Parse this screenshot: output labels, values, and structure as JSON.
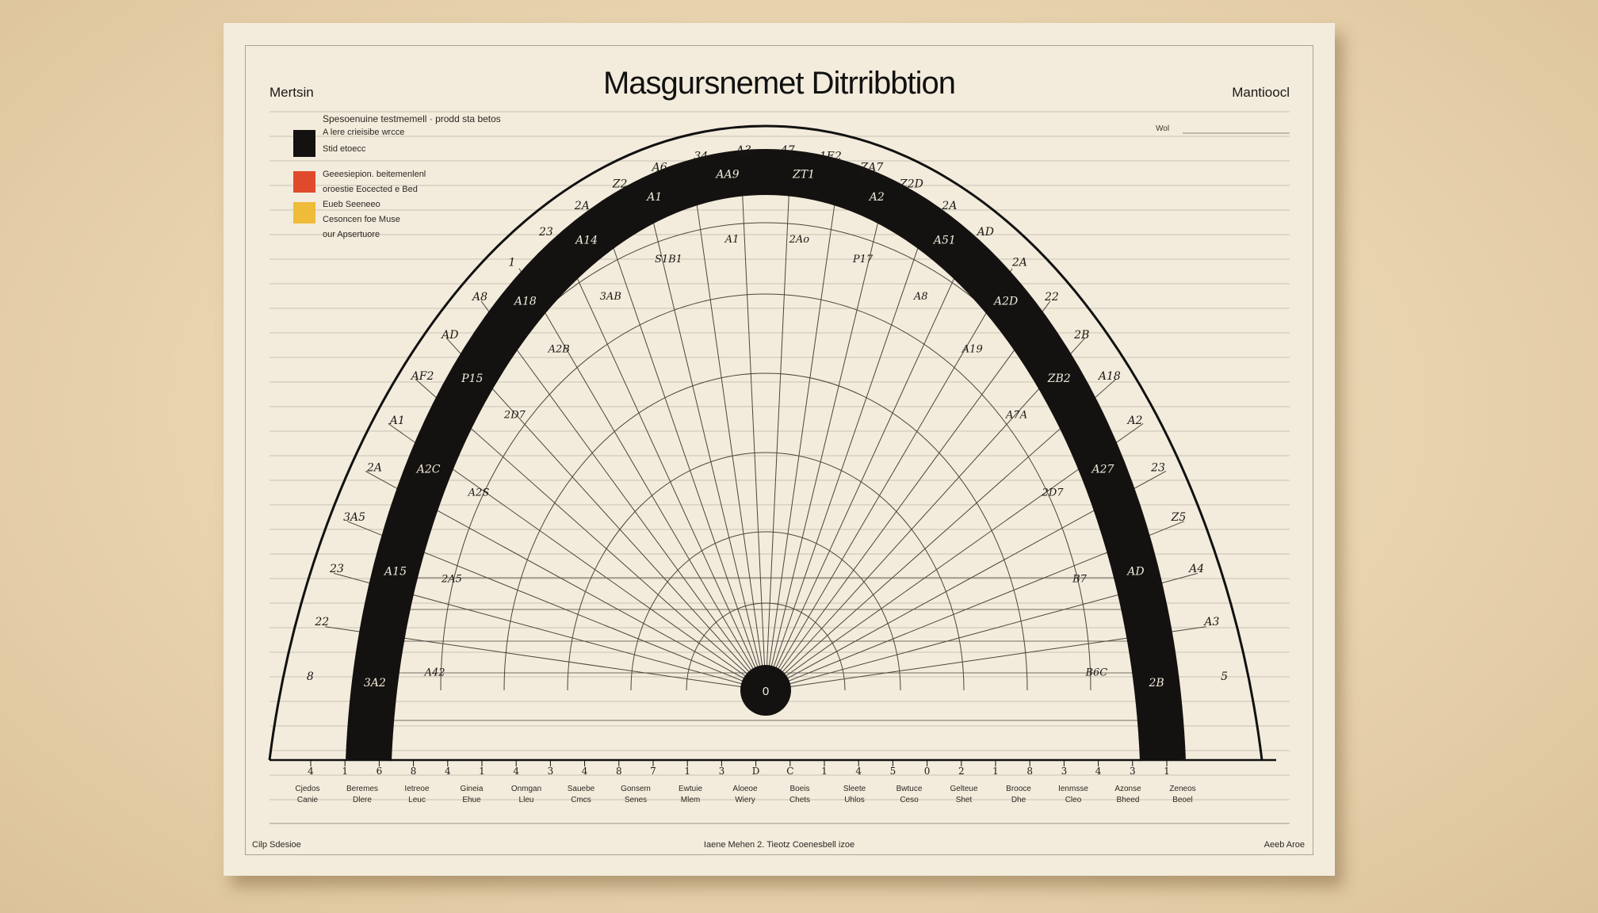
{
  "document": {
    "title": "Masgursnemet Ditrribbtion",
    "corner_left": "Mertsin",
    "corner_right": "Mantioocl",
    "right_label": "Wol",
    "legend": {
      "heading": "Spesoenuine testmemell · prodd sta betos",
      "items": [
        {
          "color": "#141210",
          "lines": [
            "A lere crieisibe wrcce",
            "Stid etoecc"
          ]
        },
        {
          "color": "#e04a2c",
          "lines": [
            "Geeesiepion. beitemenlenl",
            "oroestie Eocected e Bed"
          ]
        },
        {
          "color": "#efbc3a",
          "lines": [
            "Eueb Seeneeo",
            "Cesoncen foe Muse"
          ]
        }
      ],
      "extra_line": "our Apsertuore"
    },
    "footer": {
      "left": "Cilp Sdesioe",
      "center": "Iaene Mehen 2. Tieotz Coenesbell izoe",
      "right": "Aeeb Aroe"
    }
  },
  "diagram": {
    "colors": {
      "ink": "#111111",
      "grid": "#4a453d",
      "band": "#141210",
      "paper": "#f3ecdc"
    },
    "band_labels": [
      "3A2",
      "A15",
      "A2C",
      "P15",
      "A18",
      "A14",
      "A1",
      "AA9",
      "ZT1",
      "A2",
      "A51",
      "A2D",
      "ZB2",
      "A27",
      "AD",
      "2B"
    ],
    "inner_labels": [
      "A42",
      "2A5",
      "A2S",
      "2D7",
      "A2B",
      "3AB",
      "S1B1",
      "A1",
      "2Ao",
      "P17",
      "A8",
      "A19",
      "A7A",
      "2D7",
      "B7",
      "B6C"
    ],
    "outer_labels": [
      "8",
      "22",
      "23",
      "3A5",
      "2A",
      "A1",
      "AF2",
      "AD",
      "A8",
      "1",
      "23",
      "2A",
      "Z2",
      "A6",
      "34",
      "A3",
      "47",
      "1E2",
      "ZA7",
      "Z2D",
      "2A",
      "AD",
      "2A",
      "22",
      "2B",
      "A18",
      "A2",
      "23",
      "Z5",
      "A4",
      "A3",
      "5"
    ],
    "baseline_ticks": [
      "4",
      "1",
      "6",
      "8",
      "4",
      "1",
      "4",
      "3",
      "4",
      "8",
      "7",
      "1",
      "3",
      "D",
      "C",
      "1",
      "4",
      "5",
      "0",
      "2",
      "1",
      "8",
      "3",
      "4",
      "3",
      "1"
    ],
    "baseline_captions": [
      "Cjedos Canie",
      "Beremes Dlere",
      "Ietreoe Leuc",
      "Gineia Ehue",
      "Onmgan Lleu",
      "Sauebe Cmcs",
      "Gonsem Senes",
      "Ewtuie Mlem",
      "Aloeoe Wiery",
      "Boeis Chets",
      "Sleete Uhlos",
      "Bwtuce Ceso",
      "Gelteue Shet",
      "Brooce Dhe",
      "Ienmsse Cleo",
      "Azonse Bheed",
      "Zeneos Beoel"
    ]
  }
}
